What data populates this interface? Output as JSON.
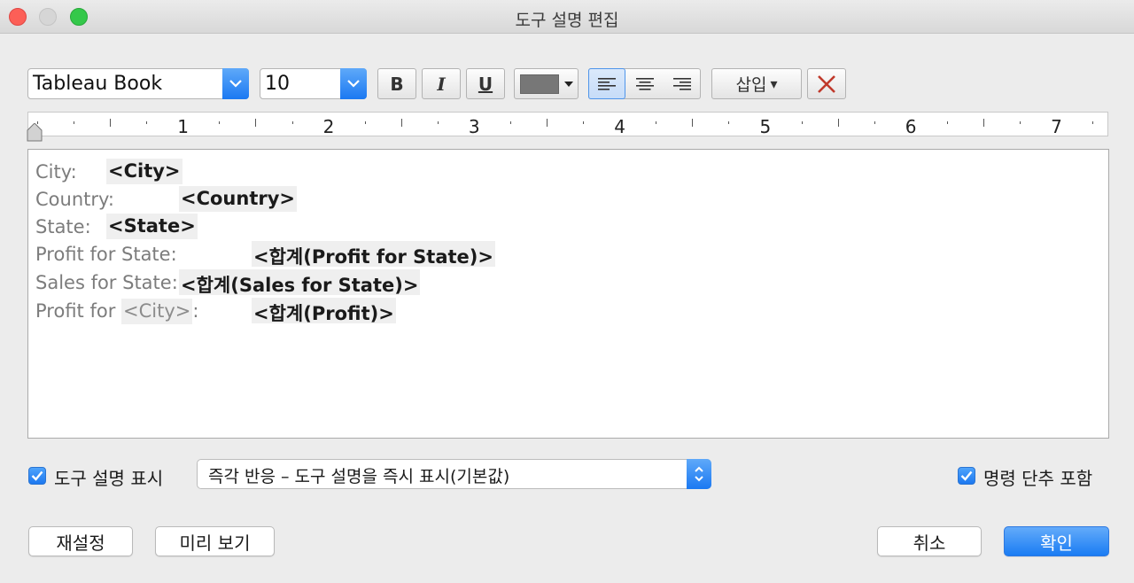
{
  "window": {
    "title": "도구 설명 편집"
  },
  "toolbar": {
    "font_family": "Tableau Book",
    "font_size": "10",
    "bold_label": "B",
    "italic_label": "I",
    "underline_label": "U",
    "text_color": "#777777",
    "insert_label": "삽입",
    "insert_arrow": "▾"
  },
  "ruler": {
    "numbers": [
      "1",
      "2",
      "3",
      "4",
      "5",
      "6",
      "7"
    ]
  },
  "editor": {
    "lines": [
      {
        "label": "City:",
        "field": "<City>"
      },
      {
        "label": "Country:",
        "field": "<Country>"
      },
      {
        "label": "State:",
        "field": "<State>"
      },
      {
        "label": "Profit for State:",
        "field": "<합계(Profit for State)>"
      },
      {
        "label": "Sales for State:",
        "field": "<합계(Sales for State)>"
      },
      {
        "label_prefix": "Profit for ",
        "label_field": "<City>",
        "label_suffix": ":",
        "field": "<합계(Profit)>"
      }
    ]
  },
  "options": {
    "show_tooltip_label": "도구 설명 표시",
    "show_tooltip_checked": true,
    "tooltip_mode": "즉각 반응 – 도구 설명을 즉시 표시(기본값)",
    "include_commands_label": "명령 단추 포함",
    "include_commands_checked": true
  },
  "buttons": {
    "reset": "재설정",
    "preview": "미리 보기",
    "cancel": "취소",
    "ok": "확인"
  },
  "colors": {
    "accent": "#1b79f2",
    "field_bg": "#efefef"
  }
}
